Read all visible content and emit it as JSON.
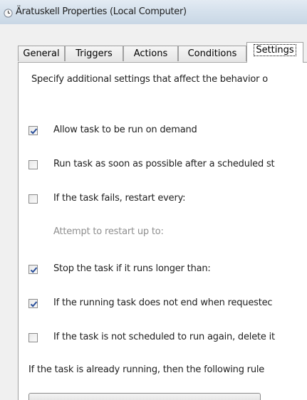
{
  "window": {
    "title": "Äratuskell Properties (Local Computer)"
  },
  "tabs": [
    {
      "label": "General",
      "active": false
    },
    {
      "label": "Triggers",
      "active": false
    },
    {
      "label": "Actions",
      "active": false
    },
    {
      "label": "Conditions",
      "active": false
    },
    {
      "label": "Settings",
      "active": true
    }
  ],
  "settings": {
    "intro": "Specify additional settings that affect the behavior o",
    "options": [
      {
        "label": "Allow task to be run on demand",
        "checked": true
      },
      {
        "label": "Run task as soon as possible after a scheduled st",
        "checked": false
      },
      {
        "label": "If the task fails, restart every:",
        "checked": false
      },
      {
        "label": "Stop the task if it runs longer than:",
        "checked": true
      },
      {
        "label": "If the running task does not end when requestec",
        "checked": true
      },
      {
        "label": "If the task is not scheduled to run again, delete it",
        "checked": false
      }
    ],
    "attempt_restart_label": "Attempt to restart up to:",
    "running_rule_label": "If the task is already running, then the following rule"
  },
  "icons": {
    "title_icon": "clock-icon",
    "checkmark": "checkmark-icon"
  },
  "colors": {
    "checkmark": "#2a4f9a",
    "disabled_text": "#8f8f8f"
  }
}
